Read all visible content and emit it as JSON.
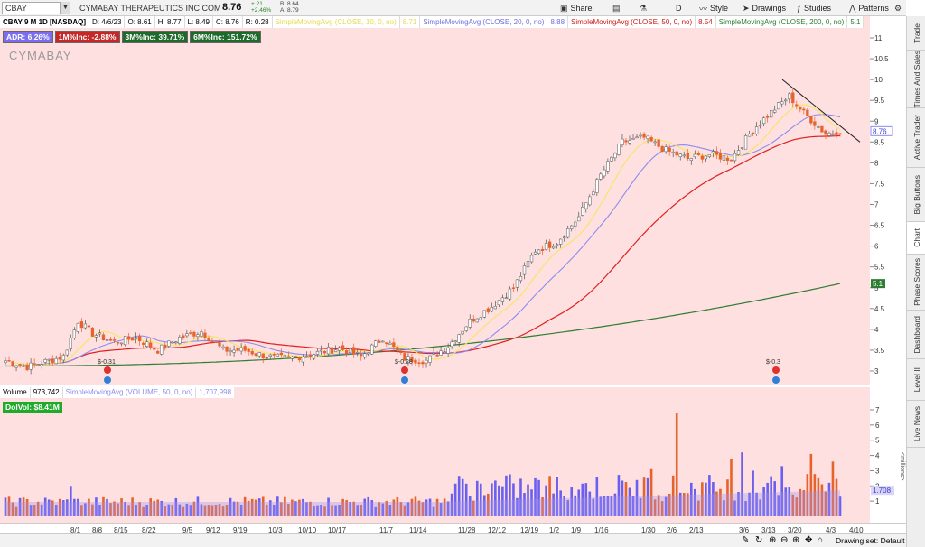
{
  "toolbar": {
    "symbol": "CBAY",
    "company": "CYMABAY THERAPEUTICS INC COM",
    "last_price": "8.76",
    "change": "+.21",
    "change_pct": "+2.46%",
    "bid": "B: 8.64",
    "ask": "A: 8.79",
    "share_label": "Share",
    "period_label": "D",
    "style_label": "Style",
    "drawings_label": "Drawings",
    "studies_label": "Studies",
    "patterns_label": "Patterns"
  },
  "legend": {
    "title": "CBAY 9 M 1D [NASDAQ]",
    "date": "D: 4/6/23",
    "open": "O: 8.61",
    "high": "H: 8.77",
    "low": "L: 8.49",
    "close": "C: 8.76",
    "range": "R: 0.28",
    "sma10": "SimpleMovingAvg (CLOSE, 10, 0, no)",
    "sma10_val": "8.71",
    "sma20": "SimpleMovingAvg (CLOSE, 20, 0, no)",
    "sma20_val": "8.88",
    "sma50": "SimpleMovingAvg (CLOSE, 50, 0, no)",
    "sma50_val": "8.54",
    "sma200": "SimpleMovingAvg (CLOSE, 200, 0, no)",
    "sma200_val": "5.1"
  },
  "badges": {
    "adr": "ADR: 6.26%",
    "m1": "1M%Inc: -2.88%",
    "m3": "3M%Inc: 39.71%",
    "m6": "6M%Inc: 151.72%"
  },
  "logo_text": "CYMABAY",
  "earnings": [
    "$-0.31",
    "$-0.28",
    "$-0.3"
  ],
  "price_axis": {
    "ticks": [
      "11",
      "10.5",
      "10",
      "9.5",
      "9",
      "8.5",
      "8",
      "7.5",
      "7",
      "6.5",
      "6",
      "5.5",
      "5",
      "4.5",
      "4",
      "3.5",
      "3"
    ],
    "last_label": "8.76",
    "sma200_label": "5.1"
  },
  "volume": {
    "label": "Volume",
    "value": "973,742",
    "sma_label": "SimpleMovingAvg (VOLUME, 50, 0, no)",
    "sma_value": "1,707,998",
    "dolvol": "DolVol: $8.41M",
    "ticks": [
      "7",
      "6",
      "5",
      "4",
      "3",
      "2",
      "1"
    ],
    "unit": "<millions>",
    "sma_axis_label": "1.708"
  },
  "x_axis": [
    "8/1",
    "8/8",
    "8/15",
    "8/22",
    "9/5",
    "9/12",
    "9/19",
    "10/3",
    "10/10",
    "10/17",
    "11/7",
    "11/14",
    "11/28",
    "12/12",
    "12/19",
    "1/2",
    "1/9",
    "1/16",
    "1/30",
    "2/6",
    "2/13",
    "3/6",
    "3/13",
    "3/20",
    "4/3",
    "4/10"
  ],
  "right_tabs": [
    "Trade",
    "Times And Sales",
    "Active Trader",
    "Big Buttons",
    "Chart",
    "Phase Scores",
    "Dashboard",
    "Level II",
    "Live News"
  ],
  "drawing_set": "Drawing set: Default",
  "colors": {
    "up": "#ffffff",
    "down": "#e8622c",
    "sma10": "#f5e663",
    "sma20": "#8c8cf0",
    "sma50": "#e02020",
    "sma200": "#2e7d32",
    "trendline": "#222222",
    "vol_up": "#6a5ff0",
    "vol_down": "#e8622c"
  }
}
